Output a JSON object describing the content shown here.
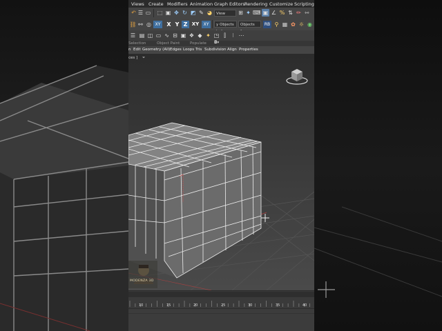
{
  "menu": {
    "items": [
      "Views",
      "Create",
      "Modifiers",
      "Animation",
      "Graph Editors",
      "Rendering",
      "Customize",
      "Scripting"
    ]
  },
  "toolbar1": {
    "view_dropdown": "View"
  },
  "toolbar2": {
    "axis_x": "X",
    "axis_y": "Y",
    "axis_z": "Z",
    "axis_xy": "XY",
    "selection_set_left": "y Objects to I",
    "selection_set_right": "Objects fror",
    "rb_button": "RB"
  },
  "ribbon": {
    "tabs": [
      "Selection",
      "Object Paint",
      "Populate"
    ],
    "subtabs": [
      "n",
      "Edit",
      "Geometry (All)",
      "Edges",
      "Loops",
      "Tris",
      "Subdivision",
      "Align",
      "Properties"
    ]
  },
  "viewport": {
    "label": "ces ]",
    "filter_icon": "filter-icon"
  },
  "timeline": {
    "ticks": [
      "10",
      "15",
      "20",
      "25",
      "30",
      "35",
      "40"
    ]
  },
  "watermark": {
    "text": "MODENZA 3D"
  },
  "colors": {
    "accent_orange": "#c6942a",
    "red_axis": "#c04040",
    "wire_white": "#f0f0f0"
  }
}
